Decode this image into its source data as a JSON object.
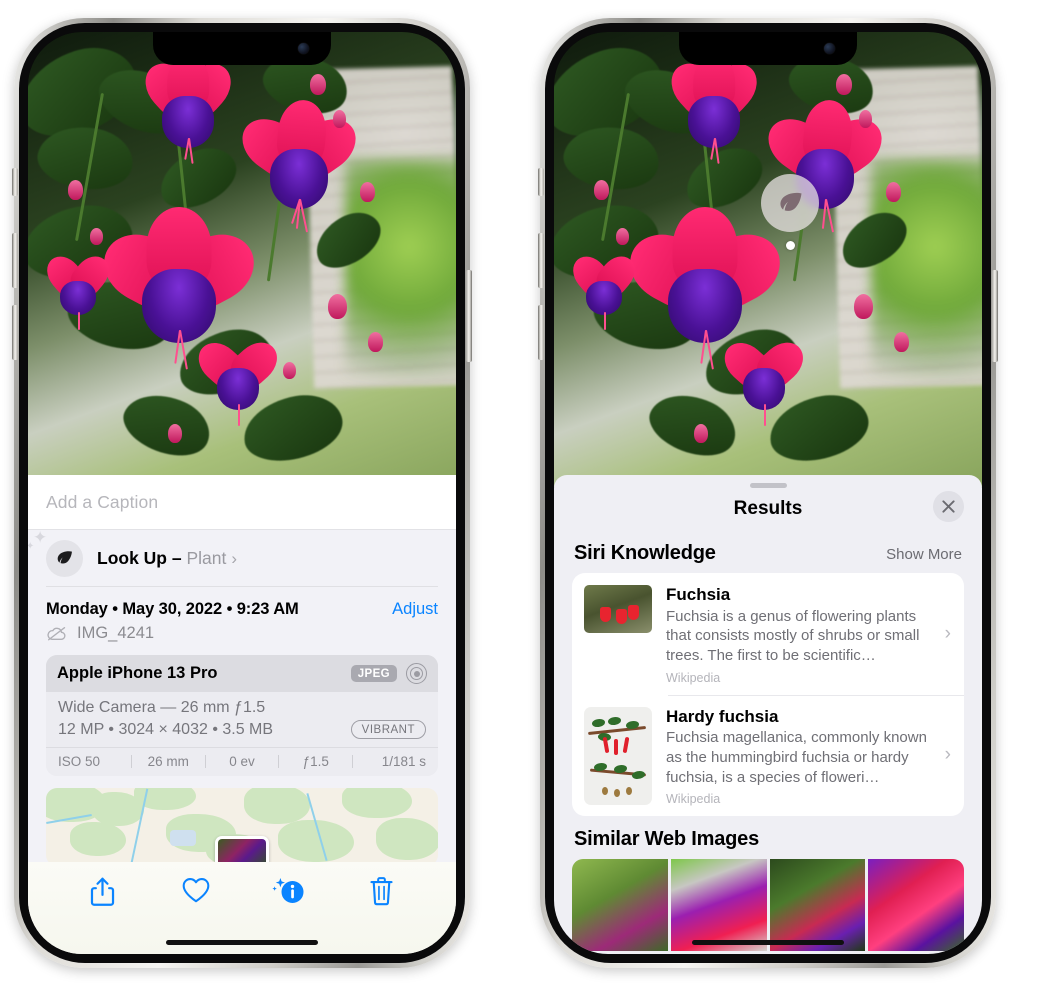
{
  "left_phone": {
    "caption_field": {
      "placeholder": "Add a Caption",
      "value": ""
    },
    "lookup": {
      "label": "Look Up –",
      "subject": "Plant",
      "chevron": "›",
      "icon": "leaf-icon"
    },
    "date_line": "Monday • May 30, 2022 • 9:23 AM",
    "adjust_label": "Adjust",
    "filename": "IMG_4241",
    "cloud_icon": "cloud-slash-icon",
    "metadata": {
      "device": "Apple iPhone 13 Pro",
      "format_badge": "JPEG",
      "aperture_icon": "aperture-icon",
      "lens_line": "Wide Camera — 26 mm ƒ1.5",
      "size_line": "12 MP • 3024 × 4032 • 3.5 MB",
      "style_badge": "VIBRANT",
      "exif": [
        "ISO 50",
        "26 mm",
        "0 ev",
        "ƒ1.5",
        "1/181 s"
      ]
    },
    "toolbar": [
      {
        "name": "share-icon",
        "label": "Share"
      },
      {
        "name": "heart-icon",
        "label": "Favorite"
      },
      {
        "name": "info-sparkle-icon",
        "label": "Info"
      },
      {
        "name": "trash-icon",
        "label": "Delete"
      }
    ]
  },
  "right_phone": {
    "lookup_badge": {
      "icon": "leaf-icon"
    },
    "sheet": {
      "title": "Results",
      "close_label": "×",
      "sections": [
        {
          "heading": "Siri Knowledge",
          "action": "Show More",
          "items": [
            {
              "name": "Fuchsia",
              "description": "Fuchsia is a genus of flowering plants that consists mostly of shrubs or small trees. The first to be scientific…",
              "source": "Wikipedia",
              "chevron": "›"
            },
            {
              "name": "Hardy fuchsia",
              "description": "Fuchsia magellanica, commonly known as the hummingbird fuchsia or hardy fuchsia, is a species of floweri…",
              "source": "Wikipedia",
              "chevron": "›"
            }
          ]
        },
        {
          "heading": "Similar Web Images",
          "action": "",
          "items": []
        }
      ]
    }
  },
  "colors": {
    "accent_blue": "#0a84ff",
    "sheet_bg": "#f2f2f7",
    "results_bg": "#efeff4",
    "card_bg": "#ffffff",
    "secondary_text": "#6f6f75",
    "tertiary_text": "#b4b4ba"
  }
}
